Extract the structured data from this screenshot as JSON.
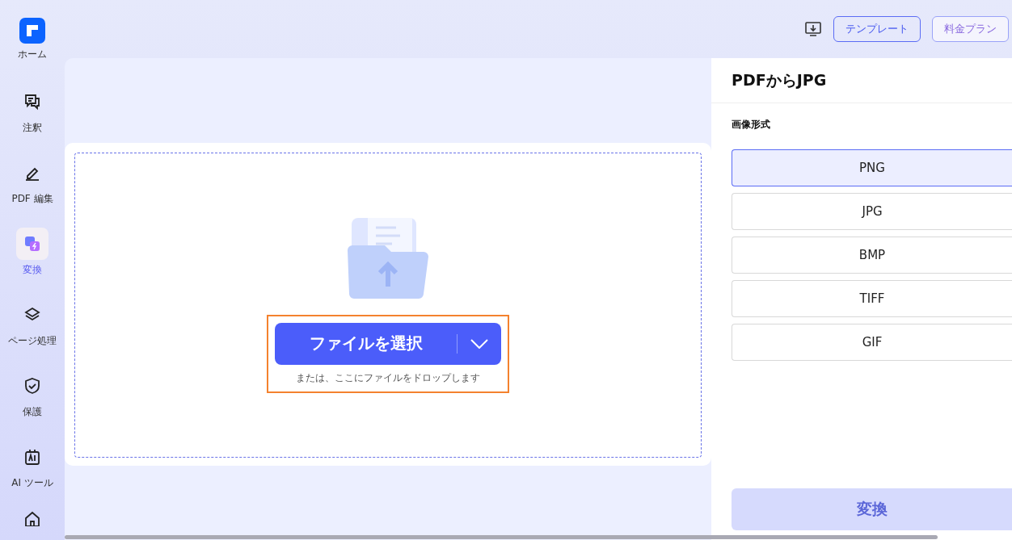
{
  "sidebar": {
    "items": [
      {
        "label": "ホーム",
        "selected": false
      },
      {
        "label": "注釈",
        "selected": false
      },
      {
        "label": "PDF 編集",
        "selected": false
      },
      {
        "label": "変換",
        "selected": true
      },
      {
        "label": "ページ処理",
        "selected": false
      },
      {
        "label": "保護",
        "selected": false
      },
      {
        "label": "AI ツール",
        "selected": false
      }
    ]
  },
  "header": {
    "buttons": [
      {
        "label": "テンプレート",
        "kind": "outline"
      },
      {
        "label": "料金プラン",
        "kind": "gradient"
      }
    ]
  },
  "upload": {
    "button": "ファイルを選択",
    "hint": "または、ここにファイルをドロップします"
  },
  "panel": {
    "title": "PDFからJPG",
    "section_label": "画像形式",
    "formats": [
      {
        "label": "PNG",
        "selected": true
      },
      {
        "label": "JPG",
        "selected": false
      },
      {
        "label": "BMP",
        "selected": false
      },
      {
        "label": "TIFF",
        "selected": false
      },
      {
        "label": "GIF",
        "selected": false
      }
    ],
    "convert": {
      "label": "変換",
      "disabled": true
    }
  }
}
